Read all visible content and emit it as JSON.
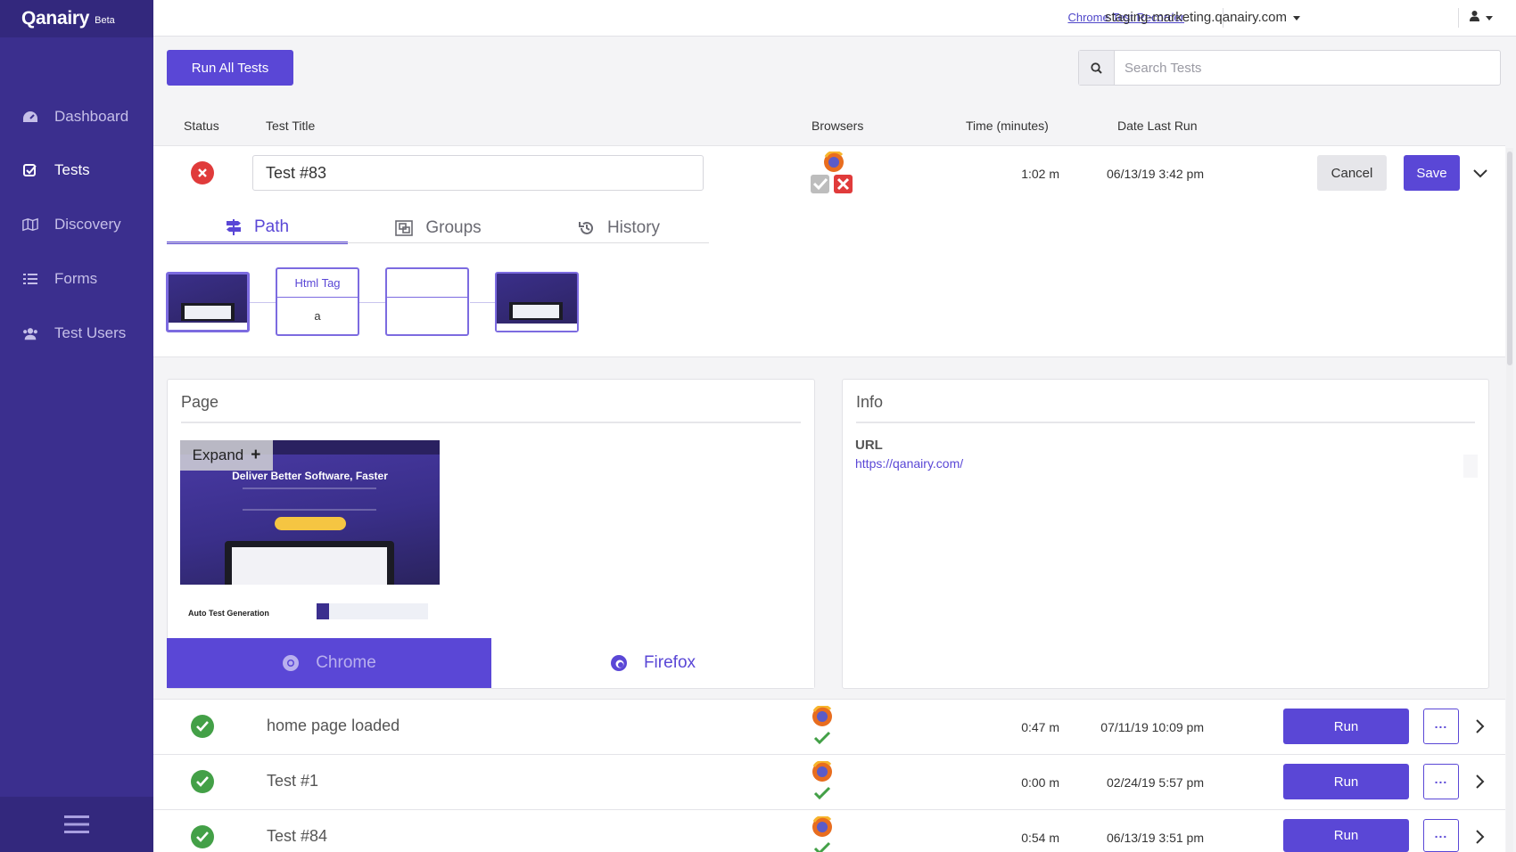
{
  "app": {
    "logo": "Qanairy",
    "badge": "Beta"
  },
  "sidebar": {
    "items": [
      {
        "label": "Dashboard",
        "icon": "dashboard-icon"
      },
      {
        "label": "Tests",
        "icon": "checkbox-icon"
      },
      {
        "label": "Discovery",
        "icon": "map-icon"
      },
      {
        "label": "Forms",
        "icon": "list-icon"
      },
      {
        "label": "Test Users",
        "icon": "users-icon"
      }
    ],
    "active": "Tests"
  },
  "topbar": {
    "recorder_link": "Chrome Test Recorder",
    "domain": "staging-marketing.qanairy.com",
    "user_icon": "user-icon"
  },
  "toolbar": {
    "run_all": "Run All Tests",
    "search_placeholder": "Search Tests",
    "search_value": ""
  },
  "columns": {
    "status": "Status",
    "title": "Test Title",
    "browsers": "Browsers",
    "time": "Time (minutes)",
    "date": "Date Last Run"
  },
  "expanded": {
    "title": "Test #83",
    "status": "failed",
    "time": "1:02 m",
    "date": "06/13/19 3:42 pm",
    "cancel": "Cancel",
    "save": "Save",
    "tabs": [
      "Path",
      "Groups",
      "History"
    ],
    "active_tab": "Path",
    "path": [
      {
        "type": "page"
      },
      {
        "type": "element",
        "header": "Html Tag",
        "value": "a"
      },
      {
        "type": "element",
        "header": "",
        "value": ""
      },
      {
        "type": "page"
      }
    ],
    "page_panel": {
      "title": "Page",
      "expand": "Expand",
      "shot_title": "Deliver Better Software, Faster",
      "shot_caption": "Auto Test Generation",
      "browser_tabs": [
        "Chrome",
        "Firefox"
      ]
    },
    "info_panel": {
      "title": "Info",
      "url_label": "URL",
      "url": "https://qanairy.com/"
    }
  },
  "tests": [
    {
      "title": "home page loaded",
      "time": "0:47 m",
      "date": "07/11/19 10:09 pm",
      "status": "passed",
      "run": "Run"
    },
    {
      "title": "Test #1",
      "time": "0:00 m",
      "date": "02/24/19 5:57 pm",
      "status": "passed",
      "run": "Run"
    },
    {
      "title": "Test #84",
      "time": "0:54 m",
      "date": "06/13/19 3:51 pm",
      "status": "passed",
      "run": "Run"
    }
  ],
  "colors": {
    "sidebar": "#3b2f8e",
    "accent": "#5a47d6",
    "pass": "#43a047",
    "fail": "#e03b3b"
  }
}
